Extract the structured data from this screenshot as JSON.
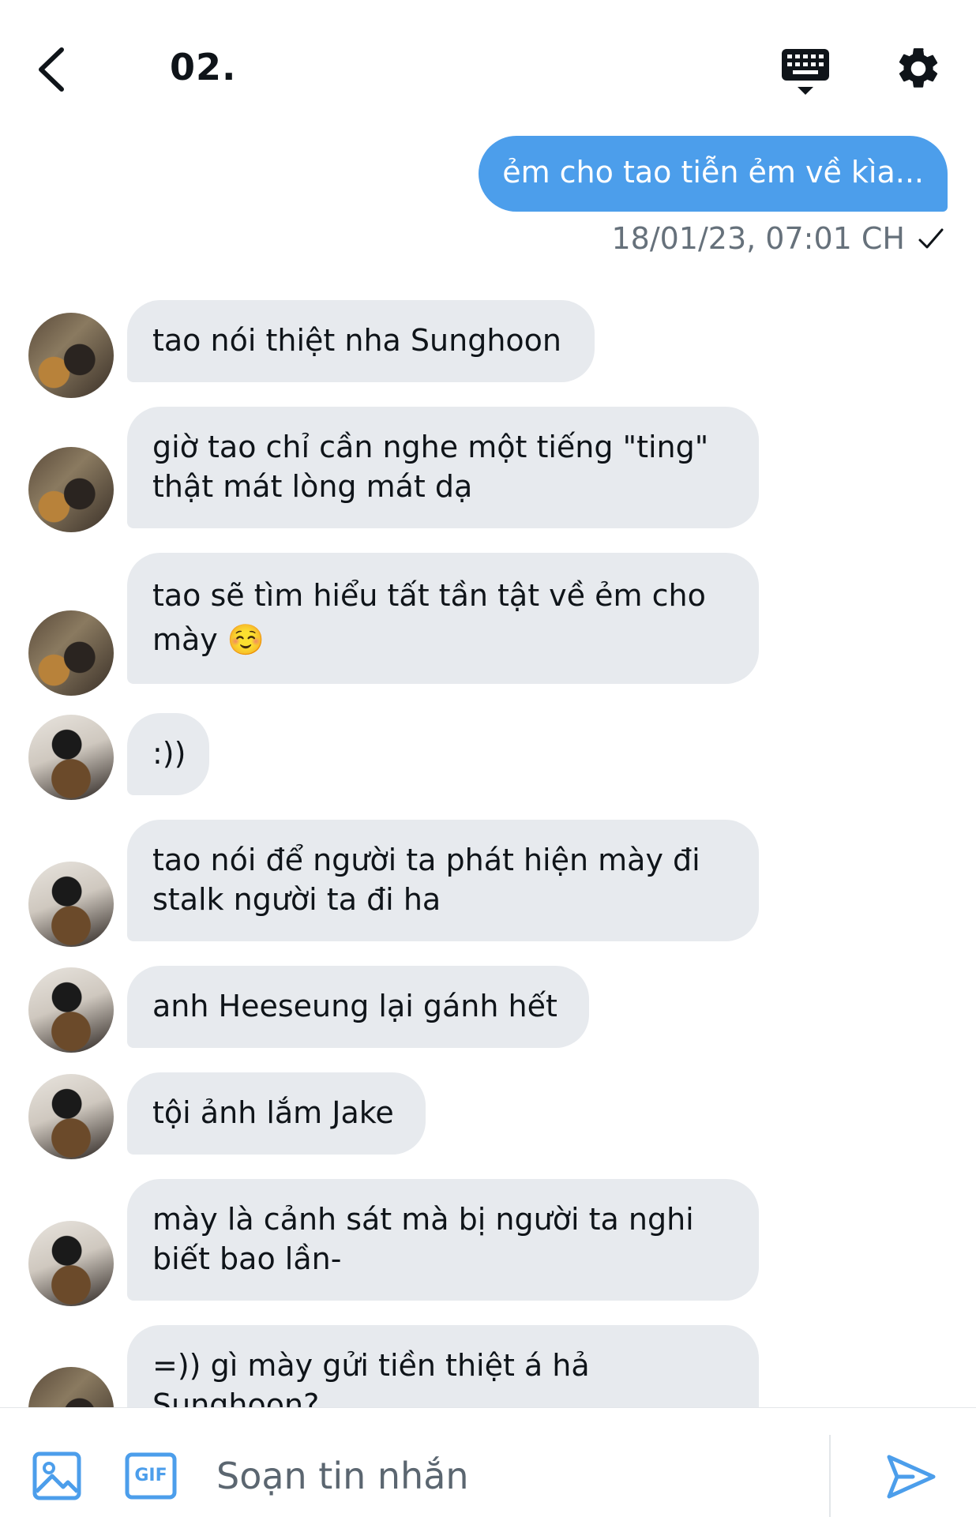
{
  "header": {
    "title": "02."
  },
  "outgoing": {
    "text": "ẻm cho tao tiễn ẻm về kìa...",
    "timestamp": "18/01/23, 07:01 CH"
  },
  "messages": [
    {
      "avatar": "a1",
      "text": "tao nói thiệt nha Sunghoon"
    },
    {
      "avatar": "a1",
      "text": "giờ tao chỉ cần nghe một tiếng \"ting\"\nthật mát lòng mát dạ"
    },
    {
      "avatar": "a1",
      "text": "tao sẽ tìm hiểu tất tần tật về ẻm cho\nmày ☺️"
    },
    {
      "avatar": "a2",
      "text": ":))"
    },
    {
      "avatar": "a2",
      "text": "tao nói để người ta phát hiện mày đi\nstalk người ta đi ha"
    },
    {
      "avatar": "a2",
      "text": "anh Heeseung lại gánh hết"
    },
    {
      "avatar": "a2",
      "text": "tội ảnh lắm Jake"
    },
    {
      "avatar": "a2",
      "text": "mày là cảnh sát mà bị người ta nghi\nbiết bao lần-"
    },
    {
      "avatar": "a1",
      "text": "=)) gì mày gửi tiền thiệt á hả\nSunghoon?"
    }
  ],
  "composer": {
    "placeholder": "Soạn tin nhắn",
    "gif_label": "GIF"
  },
  "colors": {
    "accent": "#4c9eeb",
    "incoming_bubble": "#e7eaee",
    "meta_text": "#66717b"
  }
}
